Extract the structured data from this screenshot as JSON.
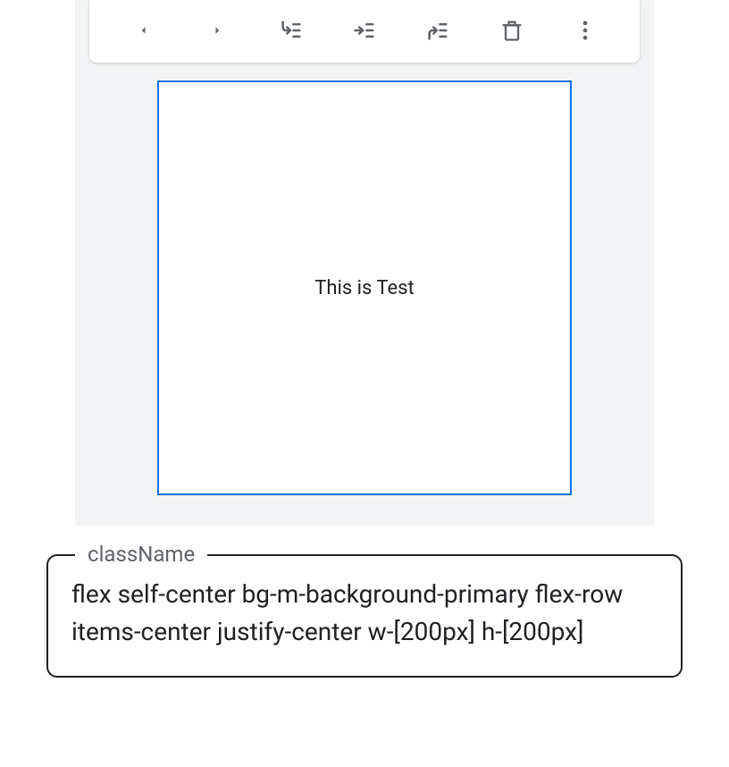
{
  "toolbar": {
    "icons": [
      "caret-left-icon",
      "caret-right-icon",
      "wrap-before-icon",
      "wrap-into-icon",
      "wrap-after-icon",
      "delete-icon",
      "more-icon"
    ]
  },
  "selectedElement": {
    "text": "This is Test"
  },
  "propertyPanel": {
    "label": "className",
    "value": "flex self-center bg-m-background-primary flex-row items-center justify-center w-[200px] h-[200px]"
  },
  "colors": {
    "selectionBorder": "#1a73e8",
    "canvasBg": "#f1f3f4",
    "iconColor": "#5f6368",
    "textColor": "#202124"
  }
}
